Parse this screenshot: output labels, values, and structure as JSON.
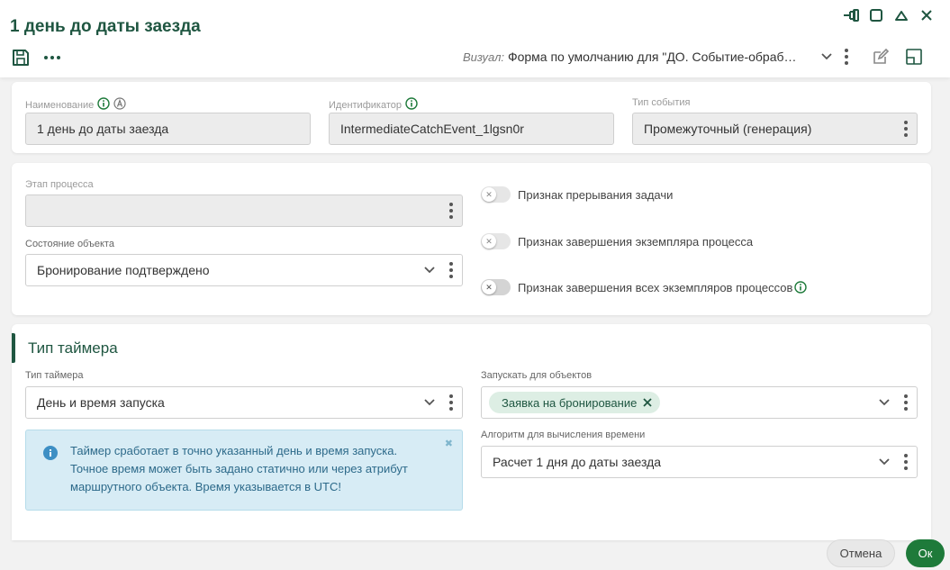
{
  "header": {
    "title": "1 день до даты заезда",
    "visual_label": "Визуал:",
    "visual_value": "Форма по умолчанию для \"ДО. Событие-обраб…"
  },
  "main": {
    "name_label": "Наименование",
    "name_value": "1 день до даты заезда",
    "id_label": "Идентификатор",
    "id_value": "IntermediateCatchEvent_1lgsn0r",
    "event_type_label": "Тип события",
    "event_type_value": "Промежуточный (генерация)"
  },
  "process": {
    "stage_label": "Этап процесса",
    "stage_value": "",
    "state_label": "Состояние объекта",
    "state_value": "Бронирование подтверждено",
    "toggle_interrupt": "Признак прерывания задачи",
    "toggle_instance_end": "Признак завершения экземпляра процесса",
    "toggle_all_end": "Признак завершения всех экземпляров процессов"
  },
  "timer": {
    "section_title": "Тип таймера",
    "type_label": "Тип таймера",
    "type_value": "День и время запуска",
    "run_for_label": "Запускать для объектов",
    "run_for_chip": "Заявка на бронирование",
    "algo_label": "Алгоритм для вычисления времени",
    "algo_value": "Расчет 1 дня до даты заезда",
    "alert_line1": "Таймер сработает в точно указанный день и время запуска.",
    "alert_line2": "Точное время может быть задано статично или через атрибут",
    "alert_line3": "маршрутного объекта. Время указывается в UTC!"
  },
  "footer": {
    "cancel": "Отмена",
    "ok": "Ок"
  },
  "colors": {
    "brand": "#1f5641",
    "ok_button": "#1e7a3a",
    "info_bg": "#d7ecf5"
  },
  "icons": [
    "pin-icon",
    "maximize-icon",
    "collapse-icon",
    "close-icon",
    "save-icon",
    "more-icon",
    "chevron-down-icon",
    "kebab-icon",
    "edit-icon",
    "layout-icon",
    "info-icon",
    "autonumber-icon",
    "info-circle-icon",
    "close-x-icon"
  ]
}
